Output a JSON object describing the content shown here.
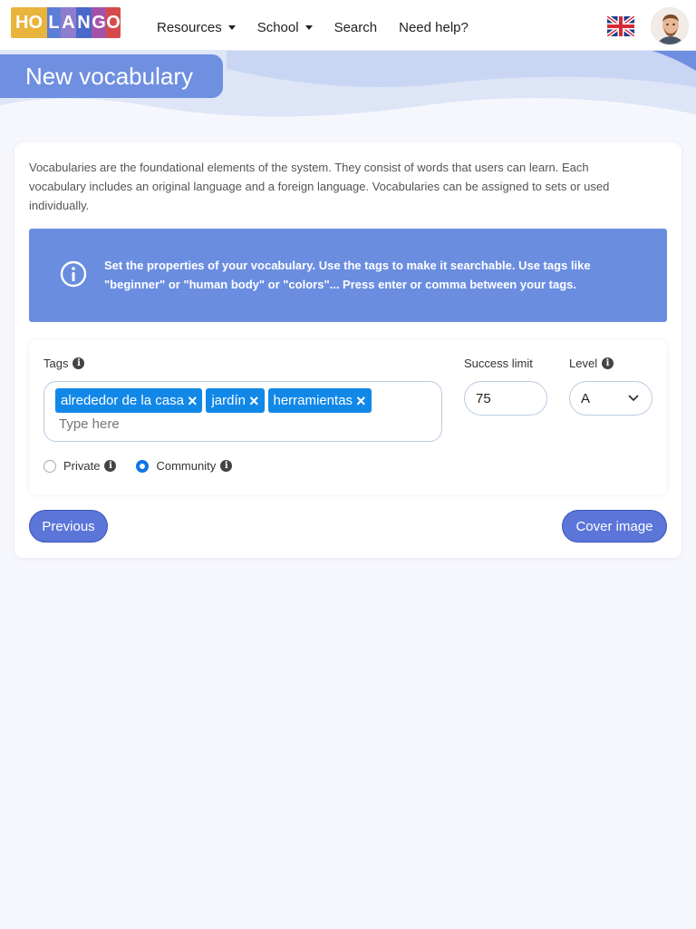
{
  "brand": {
    "logo_letters": [
      "HO",
      "L",
      "A",
      "N",
      "G",
      "O"
    ],
    "logo_colors": [
      "#e9b43c",
      "#5d7ed6",
      "#8e7ccd",
      "#4a68c9",
      "#a452a8",
      "#d64a4a"
    ]
  },
  "nav": {
    "items": [
      {
        "label": "Resources",
        "dropdown": true
      },
      {
        "label": "School",
        "dropdown": true
      },
      {
        "label": "Search",
        "dropdown": false
      },
      {
        "label": "Need help?",
        "dropdown": false
      }
    ],
    "language_flag_icon": "uk-flag-icon",
    "avatar_icon": "user-avatar"
  },
  "page": {
    "title": "New vocabulary",
    "intro": "Vocabularies are the foundational elements of the system. They consist of words that users can learn. Each vocabulary includes an original language and a foreign language. Vocabularies can be assigned to sets or used individually.",
    "info": "Set the properties of your vocabulary. Use the tags to make it searchable. Use tags like \"beginner\" or \"human body\" or \"colors\"... Press enter or comma between your tags."
  },
  "form": {
    "tags_label": "Tags",
    "tags": [
      "alrededor de la casa",
      "jardín",
      "herramientas"
    ],
    "tags_placeholder": "Type here",
    "success_limit_label": "Success limit",
    "success_limit_value": "75",
    "level_label": "Level",
    "level_value": "A",
    "visibility": {
      "options": [
        "Private",
        "Community"
      ],
      "selected": "Community"
    }
  },
  "actions": {
    "previous": "Previous",
    "next": "Cover image"
  },
  "colors": {
    "accent": "#5b75d9",
    "info_bg": "#6a8de0",
    "chip": "#1188e8",
    "title_box": "#6f8fe0"
  }
}
